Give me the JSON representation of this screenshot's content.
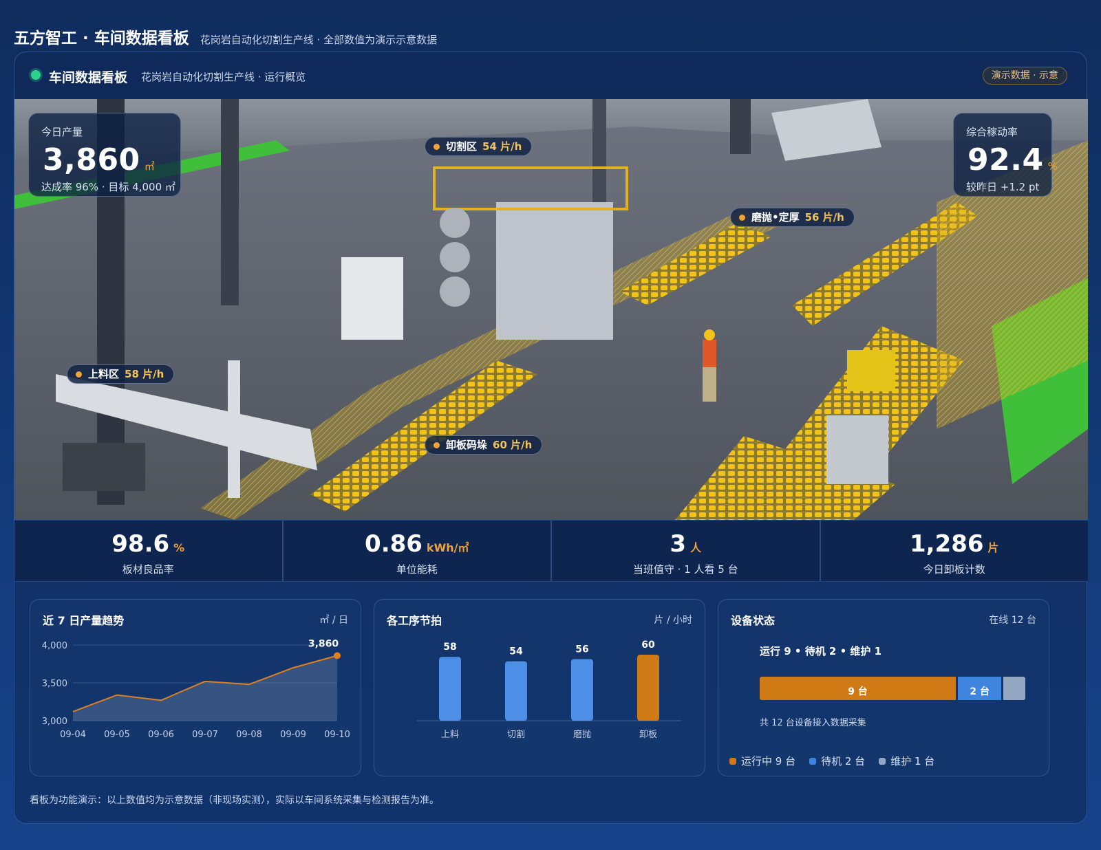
{
  "page": {
    "title": "五方智工 · 车间数据看板",
    "subtitle": "花岗岩自动化切割生产线 · 全部数值为演示示意数据"
  },
  "panel": {
    "title": "车间数据看板",
    "subtitle": "花岗岩自动化切割生产线 · 运行概览",
    "badge": "演示数据 · 示意"
  },
  "kpi": {
    "output": {
      "label": "今日产量",
      "value": "3,860",
      "unit": "㎡",
      "sub": "达成率 96% · 目标 4,000 ㎡"
    },
    "oee": {
      "label": "综合稼动率",
      "value": "92.4",
      "unit": "%",
      "sub": "较昨日 +1.2 pt"
    }
  },
  "stations": [
    {
      "name": "切割区",
      "rate": "54 片/h"
    },
    {
      "name": "磨抛•定厚",
      "rate": "56 片/h"
    },
    {
      "name": "上料区",
      "rate": "58 片/h"
    },
    {
      "name": "卸板码垛",
      "rate": "60 片/h"
    }
  ],
  "stats": [
    {
      "value": "98.6",
      "unit": "%",
      "label": "板材良品率"
    },
    {
      "value": "0.86",
      "unit": "kWh/㎡",
      "label": "单位能耗"
    },
    {
      "value": "3",
      "unit": "人",
      "label": "当班值守 · 1 人看 5 台"
    },
    {
      "value": "1,286",
      "unit": "片",
      "label": "今日卸板计数"
    }
  ],
  "cards": {
    "trend": {
      "title": "近 7 日产量趋势",
      "unit": "㎡ / 日"
    },
    "takt": {
      "title": "各工序节拍",
      "unit": "片 / 小时"
    },
    "equipment": {
      "title": "设备状态",
      "online": "在线 12 台",
      "summary": "运行 9 • 待机 2 • 维护 1",
      "segments": [
        {
          "label": "9 台",
          "value": 9,
          "color": "#d07a15"
        },
        {
          "label": "2 台",
          "value": 2,
          "color": "#3f85df"
        },
        {
          "label": "",
          "value": 1,
          "color": "#93a6c2"
        }
      ],
      "note": "共 12 台设备接入数据采集",
      "legend": [
        {
          "label": "运行中 9 台",
          "color": "#d07a15"
        },
        {
          "label": "待机 2 台",
          "color": "#3f85df"
        },
        {
          "label": "维护 1 台",
          "color": "#93a6c2"
        }
      ]
    }
  },
  "colors": {
    "accent": "#f0a33a",
    "series": "#e07f1f",
    "bar": "#4c8fe6",
    "bar_highlight": "#d07a15"
  },
  "chart_data": [
    {
      "type": "area",
      "title": "近 7 日产量趋势",
      "ylabel": "㎡ / 日",
      "x": [
        "09-04",
        "09-05",
        "09-06",
        "09-07",
        "09-08",
        "09-09",
        "09-10"
      ],
      "series": [
        {
          "values": [
            3120,
            3340,
            3270,
            3520,
            3480,
            3700,
            3860
          ]
        }
      ],
      "ylim": [
        3000,
        4000
      ],
      "yticks": [
        "3,000",
        "3,500",
        "4,000"
      ],
      "annotation": {
        "x": "09-10",
        "label": "3,860"
      }
    },
    {
      "type": "bar",
      "title": "各工序节拍",
      "ylabel": "片 / 小时",
      "categories": [
        "上料",
        "切割",
        "磨抛",
        "卸板"
      ],
      "values": [
        58,
        54,
        56,
        60
      ],
      "highlight": "卸板"
    }
  ],
  "footnote": "看板为功能演示：以上数值均为示意数据（非现场实测），实际以车间系统采集与检测报告为准。"
}
